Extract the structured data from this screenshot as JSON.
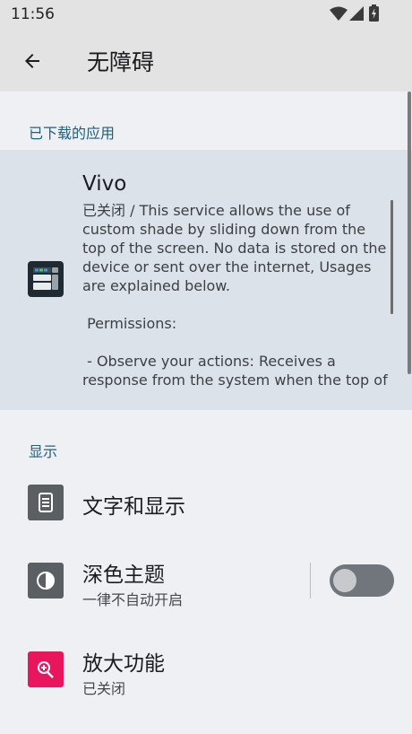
{
  "status_bar": {
    "time": "11:56",
    "icons": [
      "wifi-icon",
      "signal-icon",
      "battery-icon"
    ]
  },
  "app_bar": {
    "back_icon": "arrow-back-icon",
    "title": "无障碍"
  },
  "sections": {
    "downloaded": {
      "header": "已下载的应用",
      "service": {
        "icon": "vivo-app-icon",
        "title": "Vivo",
        "description": "已关闭 / This service allows the use of custom shade by sliding down from the top of the screen. No data is stored on the device or sent over the internet, Usages are explained below.\n\n Permissions:\n\n - Observe your actions: Receives a response from the system when the top of"
      }
    },
    "display": {
      "header": "显示",
      "items": [
        {
          "icon": "text-display-icon",
          "title": "文字和显示"
        },
        {
          "icon": "contrast-icon",
          "title": "深色主题",
          "subtitle": "一律不自动开启",
          "toggle": "off"
        },
        {
          "icon": "magnify-icon",
          "title": "放大功能",
          "subtitle": "已关闭"
        }
      ]
    }
  },
  "colors": {
    "app_bar_bg": "#e3e3e3",
    "section_header": "#1f5f7a",
    "selected_row_bg": "#dce2ea",
    "magnify_icon_bg": "#e8175d",
    "icon_bg": "#5a5f64"
  }
}
